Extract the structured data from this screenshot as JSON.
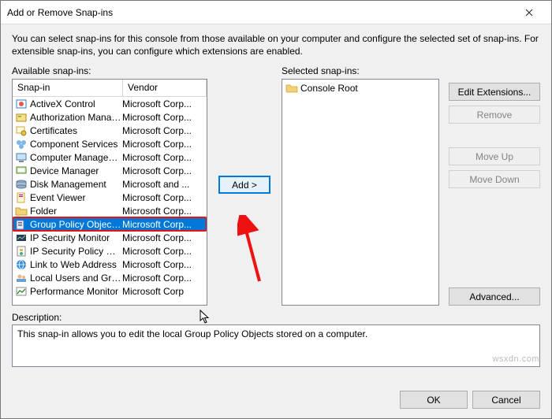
{
  "titlebar": {
    "title": "Add or Remove Snap-ins"
  },
  "intro": "You can select snap-ins for this console from those available on your computer and configure the selected set of snap-ins. For extensible snap-ins, you can configure which extensions are enabled.",
  "available": {
    "label": "Available snap-ins:",
    "headers": {
      "snapin": "Snap-in",
      "vendor": "Vendor"
    },
    "items": [
      {
        "name": "ActiveX Control",
        "vendor": "Microsoft Corp...",
        "icon": "activex"
      },
      {
        "name": "Authorization Manager",
        "vendor": "Microsoft Corp...",
        "icon": "auth"
      },
      {
        "name": "Certificates",
        "vendor": "Microsoft Corp...",
        "icon": "cert"
      },
      {
        "name": "Component Services",
        "vendor": "Microsoft Corp...",
        "icon": "component"
      },
      {
        "name": "Computer Managem...",
        "vendor": "Microsoft Corp...",
        "icon": "computer"
      },
      {
        "name": "Device Manager",
        "vendor": "Microsoft Corp...",
        "icon": "device"
      },
      {
        "name": "Disk Management",
        "vendor": "Microsoft and ...",
        "icon": "disk"
      },
      {
        "name": "Event Viewer",
        "vendor": "Microsoft Corp...",
        "icon": "event"
      },
      {
        "name": "Folder",
        "vendor": "Microsoft Corp...",
        "icon": "folder"
      },
      {
        "name": "Group Policy Object ...",
        "vendor": "Microsoft Corp...",
        "icon": "gpo",
        "selected": true,
        "highlighted": true
      },
      {
        "name": "IP Security Monitor",
        "vendor": "Microsoft Corp...",
        "icon": "ipsecmon"
      },
      {
        "name": "IP Security Policy Ma...",
        "vendor": "Microsoft Corp...",
        "icon": "ipsecpol"
      },
      {
        "name": "Link to Web Address",
        "vendor": "Microsoft Corp...",
        "icon": "link"
      },
      {
        "name": "Local Users and Gro...",
        "vendor": "Microsoft Corp...",
        "icon": "users"
      },
      {
        "name": "Performance Monitor",
        "vendor": "Microsoft Corp",
        "icon": "perf"
      }
    ]
  },
  "selected": {
    "label": "Selected snap-ins:",
    "root": "Console Root"
  },
  "buttons": {
    "add": "Add >",
    "editext": "Edit Extensions...",
    "remove": "Remove",
    "moveup": "Move Up",
    "movedown": "Move Down",
    "advanced": "Advanced...",
    "ok": "OK",
    "cancel": "Cancel"
  },
  "description": {
    "label": "Description:",
    "text": "This snap-in allows you to edit the local Group Policy Objects stored on a computer."
  },
  "watermark": "wsxdn.com"
}
